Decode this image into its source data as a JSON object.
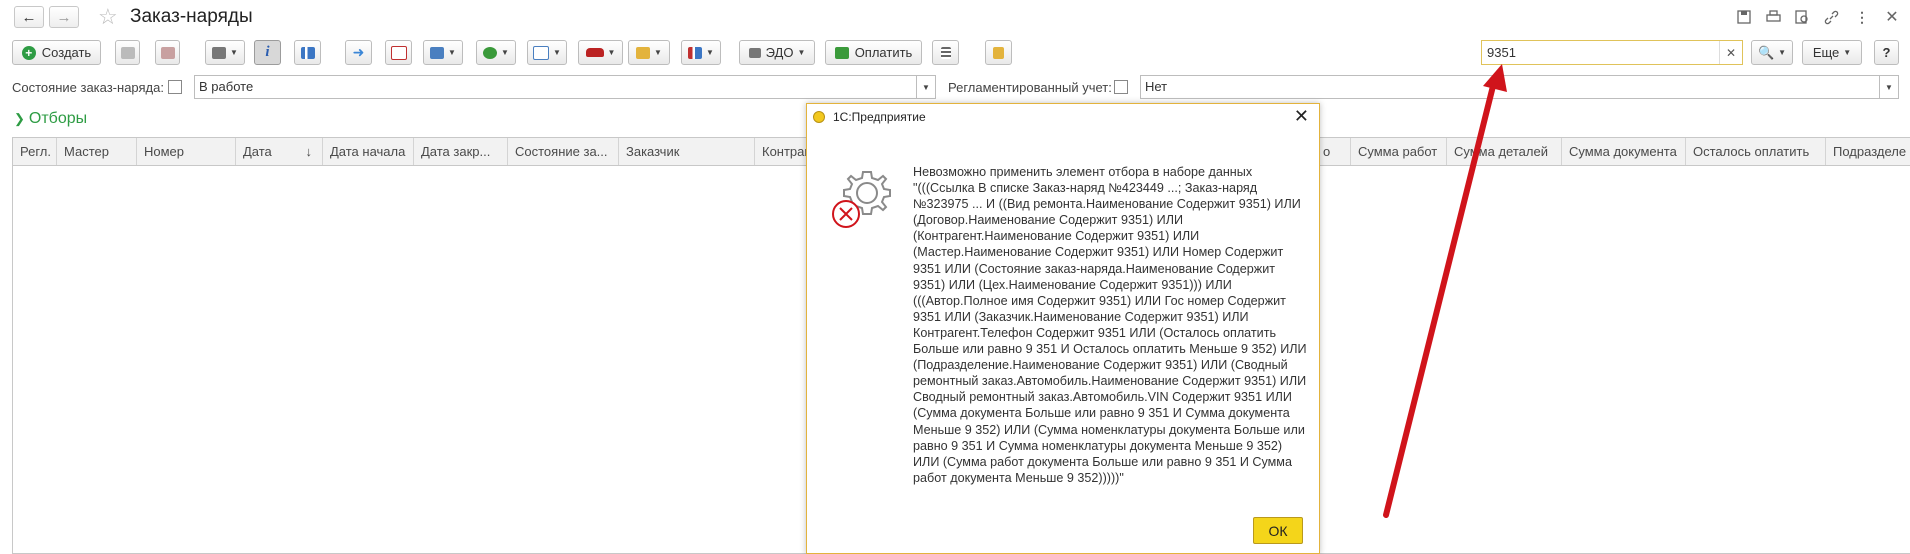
{
  "window": {
    "title": "Заказ-наряды"
  },
  "toolbar": {
    "create_label": "Создать",
    "edo_label": "ЭДО",
    "pay_label": "Оплатить",
    "more_label": "Еще"
  },
  "search": {
    "value": "9351"
  },
  "filters": {
    "state_label": "Состояние заказ-наряда:",
    "state_value": "В работе",
    "regl_label": "Регламентированный учет:",
    "regl_value": "Нет"
  },
  "selections_label": "Отборы",
  "table": {
    "columns": [
      "Регл.",
      "Мастер",
      "Номер",
      "Дата",
      "Дата начала",
      "Дата закр...",
      "Состояние за...",
      "Заказчик",
      "Контраге",
      "Сумма работ",
      "Сумма деталей",
      "Сумма документа",
      "Осталось оплатить",
      "Подразделе"
    ],
    "sort_indicator": "↓",
    "partial_col_fragment": "о"
  },
  "dialog": {
    "title": "1С:Предприятие",
    "message": "Невозможно применить элемент отбора в наборе данных\n\"(((Ссылка В списке Заказ-наряд №423449         ...; Заказ-наряд №323975        ... И ((Вид ремонта.Наименование Содержит 9351) ИЛИ (Договор.Наименование Содержит 9351) ИЛИ (Контрагент.Наименование Содержит 9351) ИЛИ (Мастер.Наименование Содержит 9351) ИЛИ Номер Содержит 9351 ИЛИ (Состояние заказ-наряда.Наименование Содержит 9351) ИЛИ (Цех.Наименование Содержит 9351))) ИЛИ (((Автор.Полное имя Содержит 9351) ИЛИ Гос номер Содержит 9351 ИЛИ (Заказчик.Наименование Содержит 9351) ИЛИ Контрагент.Телефон Содержит 9351 ИЛИ (Осталось оплатить Больше или равно 9 351 И Осталось оплатить Меньше 9 352) ИЛИ (Подразделение.Наименование Содержит 9351) ИЛИ (Сводный ремонтный заказ.Автомобиль.Наименование Содержит 9351) ИЛИ Сводный ремонтный заказ.Автомобиль.VIN Содержит 9351 ИЛИ (Сумма документа Больше или равно 9 351 И Сумма документа Меньше 9 352) ИЛИ (Сумма номенклатуры документа Больше или равно 9 351 И Сумма номенклатуры документа Меньше 9 352) ИЛИ (Сумма работ  документа Больше или равно 9 351 И Сумма работ документа Меньше 9 352)))))\"",
    "ok_label": "ОК"
  },
  "colors": {
    "accent_yellow": "#f4d51a",
    "arrow_red": "#d0141b",
    "green": "#2e9c44"
  }
}
